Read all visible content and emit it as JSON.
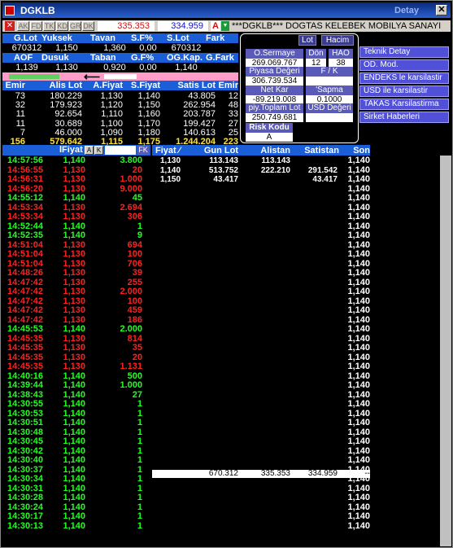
{
  "window": {
    "title": "DGKLB",
    "detay": "Detay"
  },
  "toolbar": {
    "x": "✕",
    "tabs": [
      "AK",
      "FD",
      "TK",
      "KD",
      "GR",
      "DK"
    ],
    "price1": "335.353",
    "price2": "334.959",
    "alert": "A",
    "ticker": "***DGKLB*** DOGTAS KELEBEK MOBILYA SANAYI"
  },
  "summary1": {
    "headers": [
      "G.Lot",
      "Yuksek",
      "Tavan",
      "S.F%",
      "S.Lot",
      "Fark"
    ],
    "values": [
      "670312",
      "1,150",
      "1,360",
      "0,00",
      "670312",
      ""
    ]
  },
  "summary2": {
    "headers": [
      "AOF",
      "Dusuk",
      "Taban",
      "G.F%",
      "OG.Kap.",
      "G.Fark"
    ],
    "values": [
      "1,139",
      "1,130",
      "0,920",
      "0,00",
      "1,140",
      ""
    ]
  },
  "depth": {
    "headers": [
      "Emir",
      "Alis Lot",
      "A.Fiyat",
      "S.Fiyat",
      "Satis Lot",
      "Emir"
    ],
    "rows": [
      [
        "73",
        "180.229",
        "1,130",
        "1,140",
        "43.805",
        "12"
      ],
      [
        "32",
        "179.923",
        "1,120",
        "1,150",
        "262.954",
        "48"
      ],
      [
        "11",
        "92.654",
        "1,110",
        "1,160",
        "203.787",
        "33"
      ],
      [
        "11",
        "30.689",
        "1,100",
        "1,170",
        "199.427",
        "27"
      ],
      [
        "7",
        "46.000",
        "1,090",
        "1,180",
        "140.613",
        "25"
      ],
      [
        "156",
        "579.642",
        "1,115",
        "1,175",
        "1.244.204",
        "223"
      ]
    ]
  },
  "info": {
    "lot": "Lot",
    "hacim": "Hacim",
    "osermaye": "O.Sermaye",
    "osermaye_v": "269.069.767",
    "don": "Dön",
    "don_v": "12",
    "hao": "HAO",
    "hao_v": "38",
    "piyasa": "Piyasa Değeri",
    "piyasa_v": "306.739.534",
    "fk": "F / K",
    "fk_v": "",
    "netkar": "Net Kar",
    "netkar_v": "-89.219.008",
    "sapma": "'Sapma",
    "sapma_v": "0.1000",
    "piy": "piy.Toplam Lot",
    "piy_v": "250.749.681",
    "usd": "USD Değeri",
    "usd_v": "",
    "risk": "Risk Kodu",
    "risk_v": "A"
  },
  "side_buttons": [
    "Teknik Detay",
    "OD. Mod.",
    "ENDEKS le karsilastir",
    "USD ile karsilastir",
    "TAKAS Karsilastirma",
    "Sirket Haberleri"
  ],
  "trades_header": {
    "fiyat": "lFiyat",
    "a": "A",
    "k": "K",
    "fk": "FK"
  },
  "trades": [
    [
      "14:57:56",
      "1,140",
      "3.800",
      "g"
    ],
    [
      "14:56:55",
      "1,130",
      "20",
      "r"
    ],
    [
      "14:56:31",
      "1,130",
      "1.000",
      "r"
    ],
    [
      "14:56:20",
      "1,130",
      "9.000",
      "r"
    ],
    [
      "14:55:12",
      "1,140",
      "45",
      "g"
    ],
    [
      "14:53:34",
      "1,130",
      "2.694",
      "r"
    ],
    [
      "14:53:34",
      "1,130",
      "306",
      "r"
    ],
    [
      "14:52:44",
      "1,140",
      "1",
      "g"
    ],
    [
      "14:52:35",
      "1,140",
      "9",
      "g"
    ],
    [
      "14:51:04",
      "1,130",
      "694",
      "r"
    ],
    [
      "14:51:04",
      "1,130",
      "100",
      "r"
    ],
    [
      "14:51:04",
      "1,130",
      "706",
      "r"
    ],
    [
      "14:48:26",
      "1,130",
      "39",
      "r"
    ],
    [
      "14:47:42",
      "1,130",
      "255",
      "r"
    ],
    [
      "14:47:42",
      "1,130",
      "2.000",
      "r"
    ],
    [
      "14:47:42",
      "1,130",
      "100",
      "r"
    ],
    [
      "14:47:42",
      "1,130",
      "459",
      "r"
    ],
    [
      "14:47:42",
      "1,130",
      "186",
      "r"
    ],
    [
      "14:45:53",
      "1,140",
      "2.000",
      "g"
    ],
    [
      "14:45:35",
      "1,130",
      "814",
      "r"
    ],
    [
      "14:45:35",
      "1,130",
      "35",
      "r"
    ],
    [
      "14:45:35",
      "1,130",
      "20",
      "r"
    ],
    [
      "14:45:35",
      "1,130",
      "1.131",
      "r"
    ],
    [
      "14:40:16",
      "1,140",
      "500",
      "g"
    ],
    [
      "14:39:44",
      "1,140",
      "1.000",
      "g"
    ],
    [
      "14:38:43",
      "1,140",
      "27",
      "g"
    ],
    [
      "14:30:55",
      "1,140",
      "1",
      "g"
    ],
    [
      "14:30:53",
      "1,140",
      "1",
      "g"
    ],
    [
      "14:30:51",
      "1,140",
      "1",
      "g"
    ],
    [
      "14:30:48",
      "1,140",
      "1",
      "g"
    ],
    [
      "14:30:45",
      "1,140",
      "1",
      "g"
    ],
    [
      "14:30:42",
      "1,140",
      "1",
      "g"
    ],
    [
      "14:30:40",
      "1,140",
      "1",
      "g"
    ],
    [
      "14:30:37",
      "1,140",
      "1",
      "g"
    ],
    [
      "14:30:34",
      "1,140",
      "1",
      "g"
    ],
    [
      "14:30:31",
      "1,140",
      "1",
      "g"
    ],
    [
      "14:30:28",
      "1,140",
      "1",
      "g"
    ],
    [
      "14:30:24",
      "1,140",
      "1",
      "g"
    ],
    [
      "14:30:17",
      "1,140",
      "1",
      "g"
    ],
    [
      "14:30:13",
      "1,140",
      "1",
      "g"
    ]
  ],
  "dist": {
    "headers": [
      "Fiyat ⁄",
      "Gun Lot",
      "Alistan",
      "Satistan",
      "Son"
    ],
    "rows": [
      [
        "1,130",
        "113.143",
        "113.143",
        "",
        ""
      ],
      [
        "1,140",
        "513.752",
        "222.210",
        "291.542",
        ""
      ],
      [
        "1,150",
        "43.417",
        "",
        "43.417",
        ""
      ]
    ],
    "totals": [
      "670.312",
      "335.353",
      "334.959",
      "--"
    ]
  },
  "son_values": [
    "1,140",
    "1,140",
    "1,140",
    "1,140",
    "1,140",
    "1,140",
    "1,140",
    "1,140",
    "1,140",
    "1,140",
    "1,140",
    "1,140",
    "1,140",
    "1,140",
    "1,140",
    "1,140",
    "1,140",
    "1,140",
    "1,140",
    "1,140",
    "1,140",
    "1,140",
    "1,140",
    "1,140",
    "1,140",
    "1,140",
    "1,140",
    "1,140",
    "1,140",
    "1,140",
    "1,140",
    "1,140",
    "1,140",
    "1,140",
    "1,140",
    "1,140",
    "1,140",
    "1,140",
    "1,140",
    "1,140"
  ],
  "colors": {
    "header_blue": "#1a5fd8",
    "pink": "#ff2060",
    "green": "#20ff20",
    "red": "#ff2020",
    "yellow": "#ffe040"
  }
}
